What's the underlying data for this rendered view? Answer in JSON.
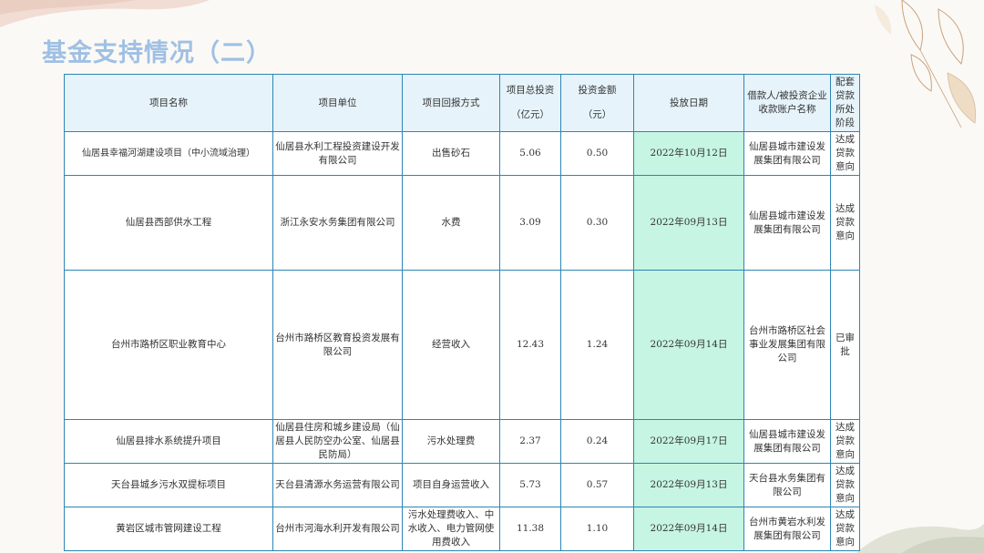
{
  "page": {
    "title": "基金支持情况（二）"
  },
  "colors": {
    "title": "#9fc0e4",
    "border": "#2d86b4",
    "header_bg": "#e6f3fa",
    "date_bg": "#c6f5e3"
  },
  "table": {
    "headers": {
      "name": "项目名称",
      "unit": "项目单位",
      "return_method": "项目回报方式",
      "total_invest": "项目总投资",
      "total_invest_unit": "（亿元）",
      "amount": "投资金额",
      "amount_unit": "（元）",
      "date": "投放日期",
      "borrower": "借款人/被投资企业收款账户名称",
      "loan_stage": "配套贷款所处阶段"
    },
    "rows": [
      {
        "name": "仙居县幸福河湖建设项目（中小流域治理）",
        "unit": "仙居县水利工程投资建设开发有限公司",
        "return_method": "出售砂石",
        "total_invest": "5.06",
        "amount": "0.50",
        "date": "2022年10月12日",
        "borrower": "仙居县城市建设发展集团有限公司",
        "loan_stage": "达成贷款意向"
      },
      {
        "name": "仙居县西部供水工程",
        "unit": "浙江永安水务集团有限公司",
        "return_method": "水费",
        "total_invest": "3.09",
        "amount": "0.30",
        "date": "2022年09月13日",
        "borrower": "仙居县城市建设发展集团有限公司",
        "loan_stage": "达成贷款意向"
      },
      {
        "name": "台州市路桥区职业教育中心",
        "unit": "台州市路桥区教育投资发展有限公司",
        "return_method": "经营收入",
        "total_invest": "12.43",
        "amount": "1.24",
        "date": "2022年09月14日",
        "borrower": "台州市路桥区社会事业发展集团有限公司",
        "loan_stage": "已审批"
      },
      {
        "name": "仙居县排水系统提升项目",
        "unit": "仙居县住房和城乡建设局（仙居县人民防空办公室、仙居县民防局）",
        "return_method": "污水处理费",
        "total_invest": "2.37",
        "amount": "0.24",
        "date": "2022年09月17日",
        "borrower": "仙居县城市建设发展集团有限公司",
        "loan_stage": "达成贷款意向"
      },
      {
        "name": "天台县城乡污水双提标项目",
        "unit": "天台县清源水务运营有限公司",
        "return_method": "项目自身运营收入",
        "total_invest": "5.73",
        "amount": "0.57",
        "date": "2022年09月13日",
        "borrower": "天台县水务集团有限公司",
        "loan_stage": "达成贷款意向"
      },
      {
        "name": "黄岩区城市管网建设工程",
        "unit": "台州市河海水利开发有限公司",
        "return_method": "污水处理费收入、中水收入、电力管网使用费收入",
        "total_invest": "11.38",
        "amount": "1.10",
        "date": "2022年09月14日",
        "borrower": "台州市黄岩水利发展集团有限公司",
        "loan_stage": "达成贷款意向"
      }
    ]
  }
}
